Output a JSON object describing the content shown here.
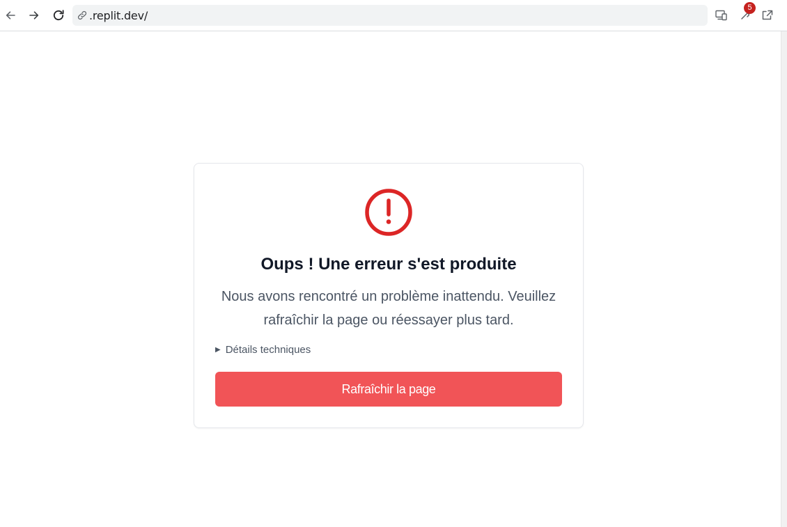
{
  "browser": {
    "url": ".replit.dev/",
    "extensions_badge": "5",
    "icons": {
      "back": "arrow-left-icon",
      "forward": "arrow-right-icon",
      "reload": "reload-icon",
      "link": "link-icon",
      "devices": "devices-icon",
      "extension": "puzzle-icon",
      "open_external": "external-link-icon"
    }
  },
  "error_card": {
    "icon": "exclamation-circle-icon",
    "title": "Oups ! Une erreur s'est produite",
    "message": "Nous avons rencontré un problème inattendu. Veuillez rafraîchir la page ou réessayer plus tard.",
    "details_label": "Détails techniques",
    "refresh_label": "Rafraîchir la page"
  },
  "colors": {
    "accent_red": "#f15457",
    "icon_red": "#dc2626",
    "title_text": "#111827",
    "body_text": "#4b5563"
  }
}
